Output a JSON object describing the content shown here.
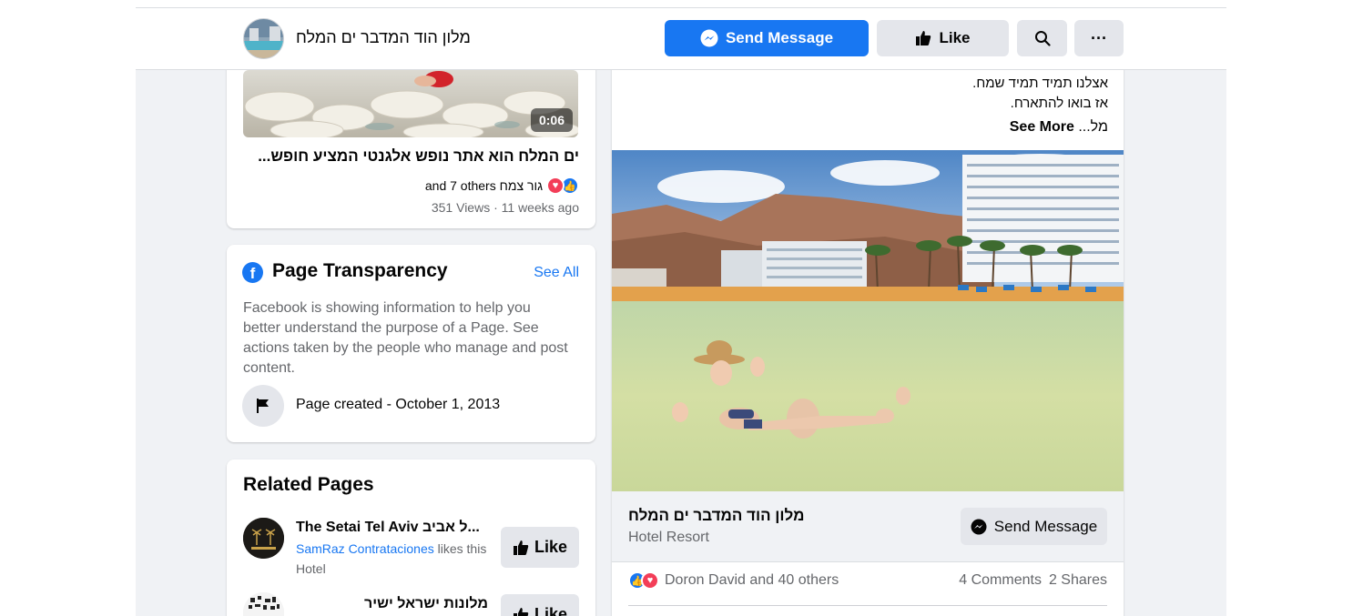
{
  "header": {
    "page_name": "מלון הוד המדבר ים המלח",
    "send_message_label": "Send Message",
    "like_label": "Like",
    "more_label": "···"
  },
  "video_card": {
    "duration": "0:06",
    "title": "ים המלח הוא אתר נופש אלגנטי המציע חופש...",
    "reactions_text": "גור צמח and 7 others",
    "views_text": "351 Views · 11 weeks ago"
  },
  "transparency": {
    "title": "Page Transparency",
    "see_all": "See All",
    "description": "Facebook is showing information to help you better understand the purpose of a Page. See actions taken by the people who manage and post content.",
    "page_created": "Page created - October 1, 2013"
  },
  "related": {
    "title": "Related Pages",
    "items": [
      {
        "name": "The Setai Tel Aviv ל אביב...",
        "liker": "SamRaz Contrataciones",
        "liker_suffix": "likes this",
        "category": "Hotel",
        "like_label": "Like"
      },
      {
        "name": "מלונות ישראל ישיר",
        "like_label": "Like"
      }
    ]
  },
  "post": {
    "line1": "אצלנו תמיד תמיד שמח.",
    "line2": "אז בואו להתארח.",
    "truncated": "מל...",
    "see_more": "See More",
    "footer_name": "מלון הוד המדבר ים המלח",
    "footer_category": "Hotel Resort",
    "footer_send_label": "Send Message",
    "reactions_text": "Doron David and 40 others",
    "comments": "4 Comments",
    "shares": "2 Shares"
  },
  "colors": {
    "brand_blue": "#1877f2",
    "like_blue": "#1877f2",
    "love_red": "#f33e58",
    "button_grey": "#e4e6eb",
    "secondary_text": "#65676b"
  }
}
